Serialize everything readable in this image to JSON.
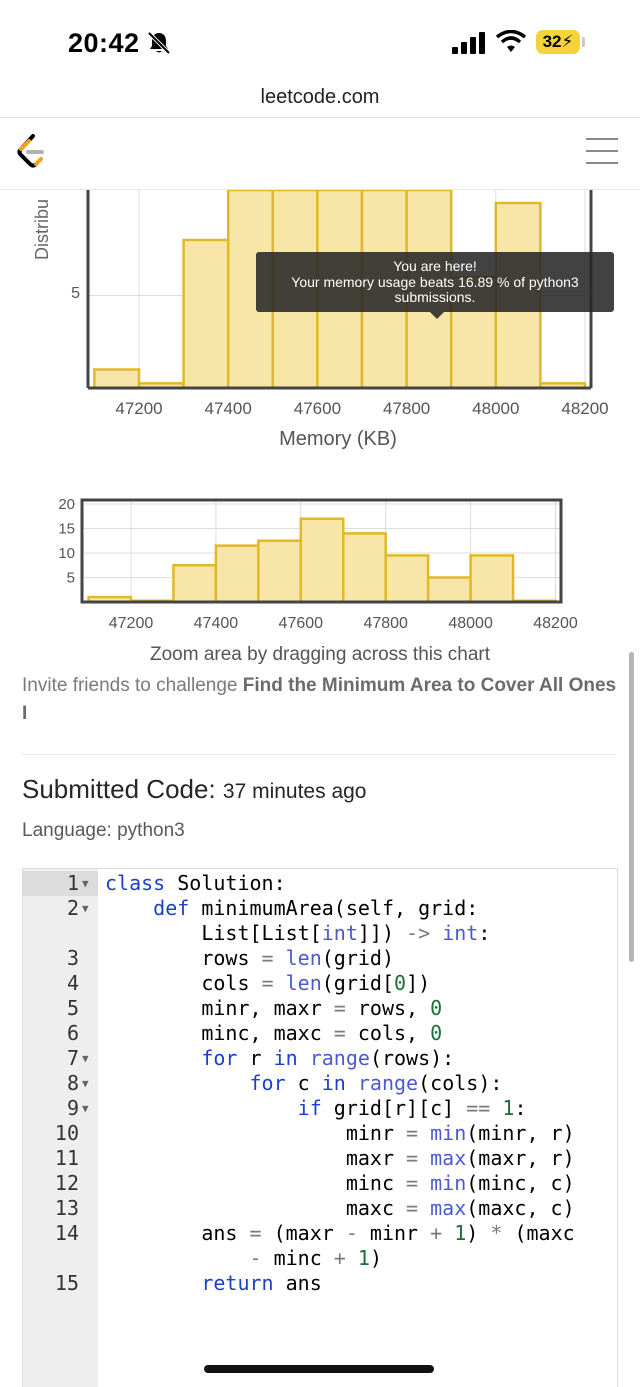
{
  "status_bar": {
    "time": "20:42",
    "battery": "32"
  },
  "browser": {
    "url": "leetcode.com"
  },
  "main_chart": {
    "ylabel": "Distribu",
    "ytick": "5",
    "xlabel": "Memory (KB)",
    "xticks": [
      "47200",
      "47400",
      "47600",
      "47800",
      "48000",
      "48200"
    ]
  },
  "tooltip": {
    "line1": "You are here!",
    "line2": "Your memory usage beats 16.89 % of python3",
    "line3": "submissions."
  },
  "zoom_chart": {
    "yticks": [
      "20",
      "15",
      "10",
      "5"
    ],
    "xticks": [
      "47200",
      "47400",
      "47600",
      "47800",
      "48000",
      "48200"
    ],
    "caption": "Zoom area by dragging across this chart"
  },
  "chart_data": [
    {
      "type": "bar",
      "title": "",
      "xlabel": "Memory (KB)",
      "ylabel": "Distribu",
      "x": [
        47150,
        47250,
        47350,
        47450,
        47550,
        47650,
        47750,
        47850,
        47950,
        48050,
        48150
      ],
      "values": [
        1,
        0.25,
        8,
        13.5,
        14,
        17,
        16,
        12,
        6,
        10,
        0.25
      ]
    },
    {
      "type": "bar",
      "title": "",
      "xlabel": "",
      "ylabel": "",
      "ylim": [
        0,
        20
      ],
      "x": [
        47150,
        47250,
        47350,
        47450,
        47550,
        47650,
        47750,
        47850,
        47950,
        48050,
        48150
      ],
      "values": [
        1,
        0.25,
        7.5,
        11.5,
        12.5,
        17,
        14,
        9.5,
        5,
        9.5,
        0.25
      ]
    }
  ],
  "invite": {
    "prefix": "Invite friends to challenge ",
    "problem": "Find the Minimum Area to Cover All Ones I"
  },
  "submission": {
    "heading": "Submitted Code: ",
    "ago": "37 minutes ago",
    "language": "Language: python3"
  },
  "code": {
    "line_numbers": [
      "1",
      "2",
      "",
      "3",
      "4",
      "5",
      "6",
      "7",
      "8",
      "9",
      "10",
      "11",
      "12",
      "13",
      "14",
      "",
      "15"
    ]
  }
}
